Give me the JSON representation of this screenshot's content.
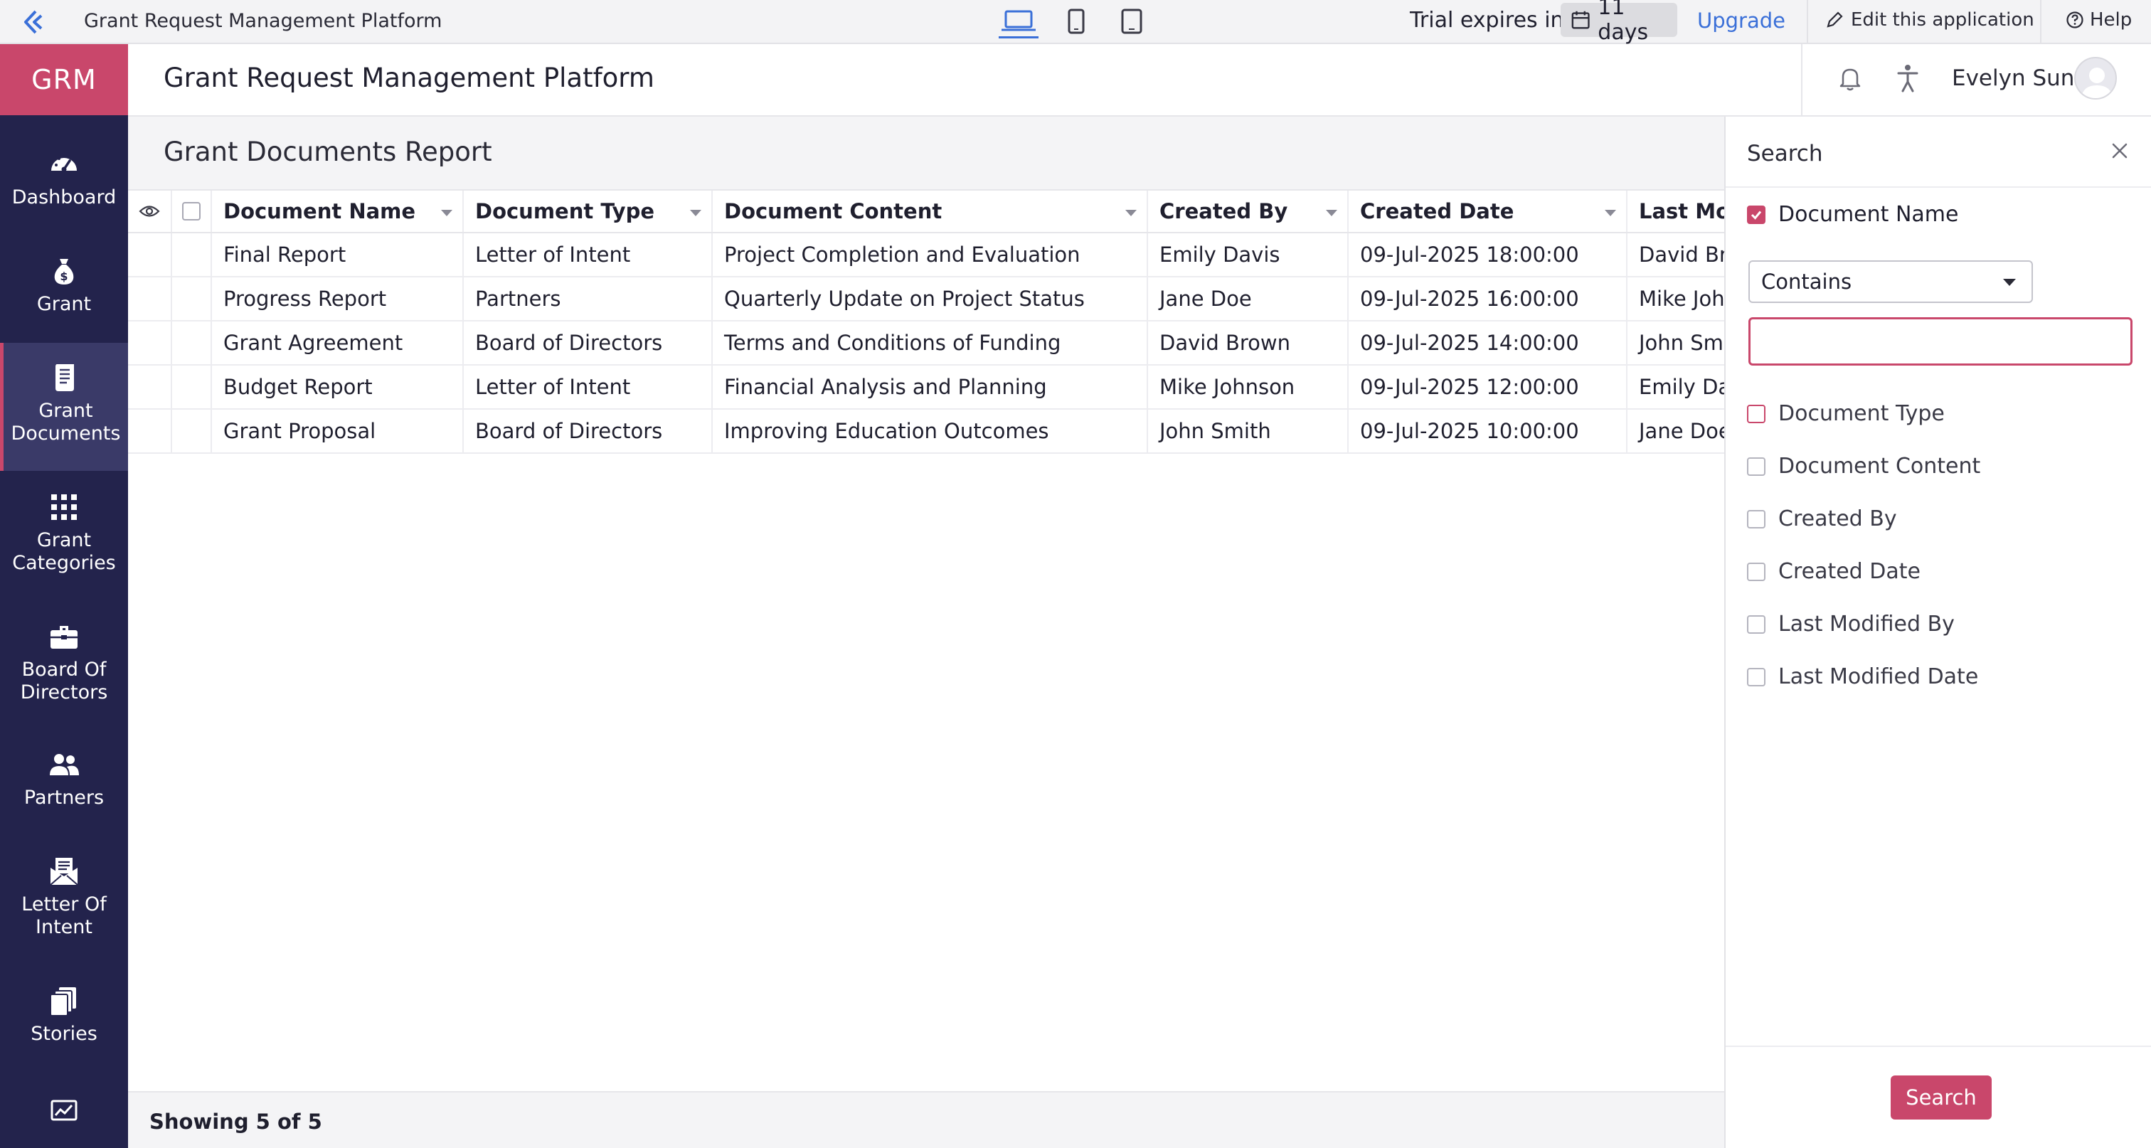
{
  "topbar": {
    "app_title": "Grant Request Management Platform",
    "trial_label": "Trial expires in",
    "trial_days": "11 days",
    "upgrade_label": "Upgrade",
    "edit_label": "Edit this application",
    "help_label": "Help"
  },
  "sidebar": {
    "brand": "GRM",
    "items": [
      {
        "label": "Dashboard",
        "icon": "dashboard-gauge-icon"
      },
      {
        "label": "Grant",
        "icon": "money-bag-icon"
      },
      {
        "label": "Grant Documents",
        "icon": "scroll-document-icon"
      },
      {
        "label": "Grant Categories",
        "icon": "grid-dots-icon"
      },
      {
        "label": "Board Of Directors",
        "icon": "briefcase-icon"
      },
      {
        "label": "Partners",
        "icon": "people-icon"
      },
      {
        "label": "Letter Of Intent",
        "icon": "envelope-open-icon"
      },
      {
        "label": "Stories",
        "icon": "stacked-pages-icon"
      }
    ],
    "active_index": 2
  },
  "header": {
    "title": "Grant Request Management Platform",
    "user_name": "Evelyn Sun"
  },
  "report": {
    "title": "Grant Documents Report",
    "columns": [
      "Document Name",
      "Document Type",
      "Document Content",
      "Created By",
      "Created Date",
      "Last Modi"
    ],
    "rows": [
      [
        "Final Report",
        "Letter of Intent",
        "Project Completion and Evaluation",
        "Emily Davis",
        "09-Jul-2025 18:00:00",
        "David Bro"
      ],
      [
        "Progress Report",
        "Partners",
        "Quarterly Update on Project Status",
        "Jane Doe",
        "09-Jul-2025 16:00:00",
        "Mike John"
      ],
      [
        "Grant Agreement",
        "Board of Directors",
        "Terms and Conditions of Funding",
        "David Brown",
        "09-Jul-2025 14:00:00",
        "John Smi"
      ],
      [
        "Budget Report",
        "Letter of Intent",
        "Financial Analysis and Planning",
        "Mike Johnson",
        "09-Jul-2025 12:00:00",
        "Emily Dav"
      ],
      [
        "Grant Proposal",
        "Board of Directors",
        "Improving Education Outcomes",
        "John Smith",
        "09-Jul-2025 10:00:00",
        "Jane Doe"
      ]
    ],
    "showing": "Showing 5 of 5"
  },
  "search_panel": {
    "title": "Search",
    "fields": [
      {
        "label": "Document Name",
        "checked": true
      },
      {
        "label": "Document Type",
        "checked": false
      },
      {
        "label": "Document Content",
        "checked": false
      },
      {
        "label": "Created By",
        "checked": false
      },
      {
        "label": "Created Date",
        "checked": false
      },
      {
        "label": "Last Modified By",
        "checked": false
      },
      {
        "label": "Last Modified Date",
        "checked": false
      }
    ],
    "operator": "Contains",
    "value": "",
    "button_label": "Search"
  },
  "colors": {
    "sidebar_bg": "#23234c",
    "brand_accent": "#c9476b",
    "link_blue": "#3a6fd8"
  }
}
